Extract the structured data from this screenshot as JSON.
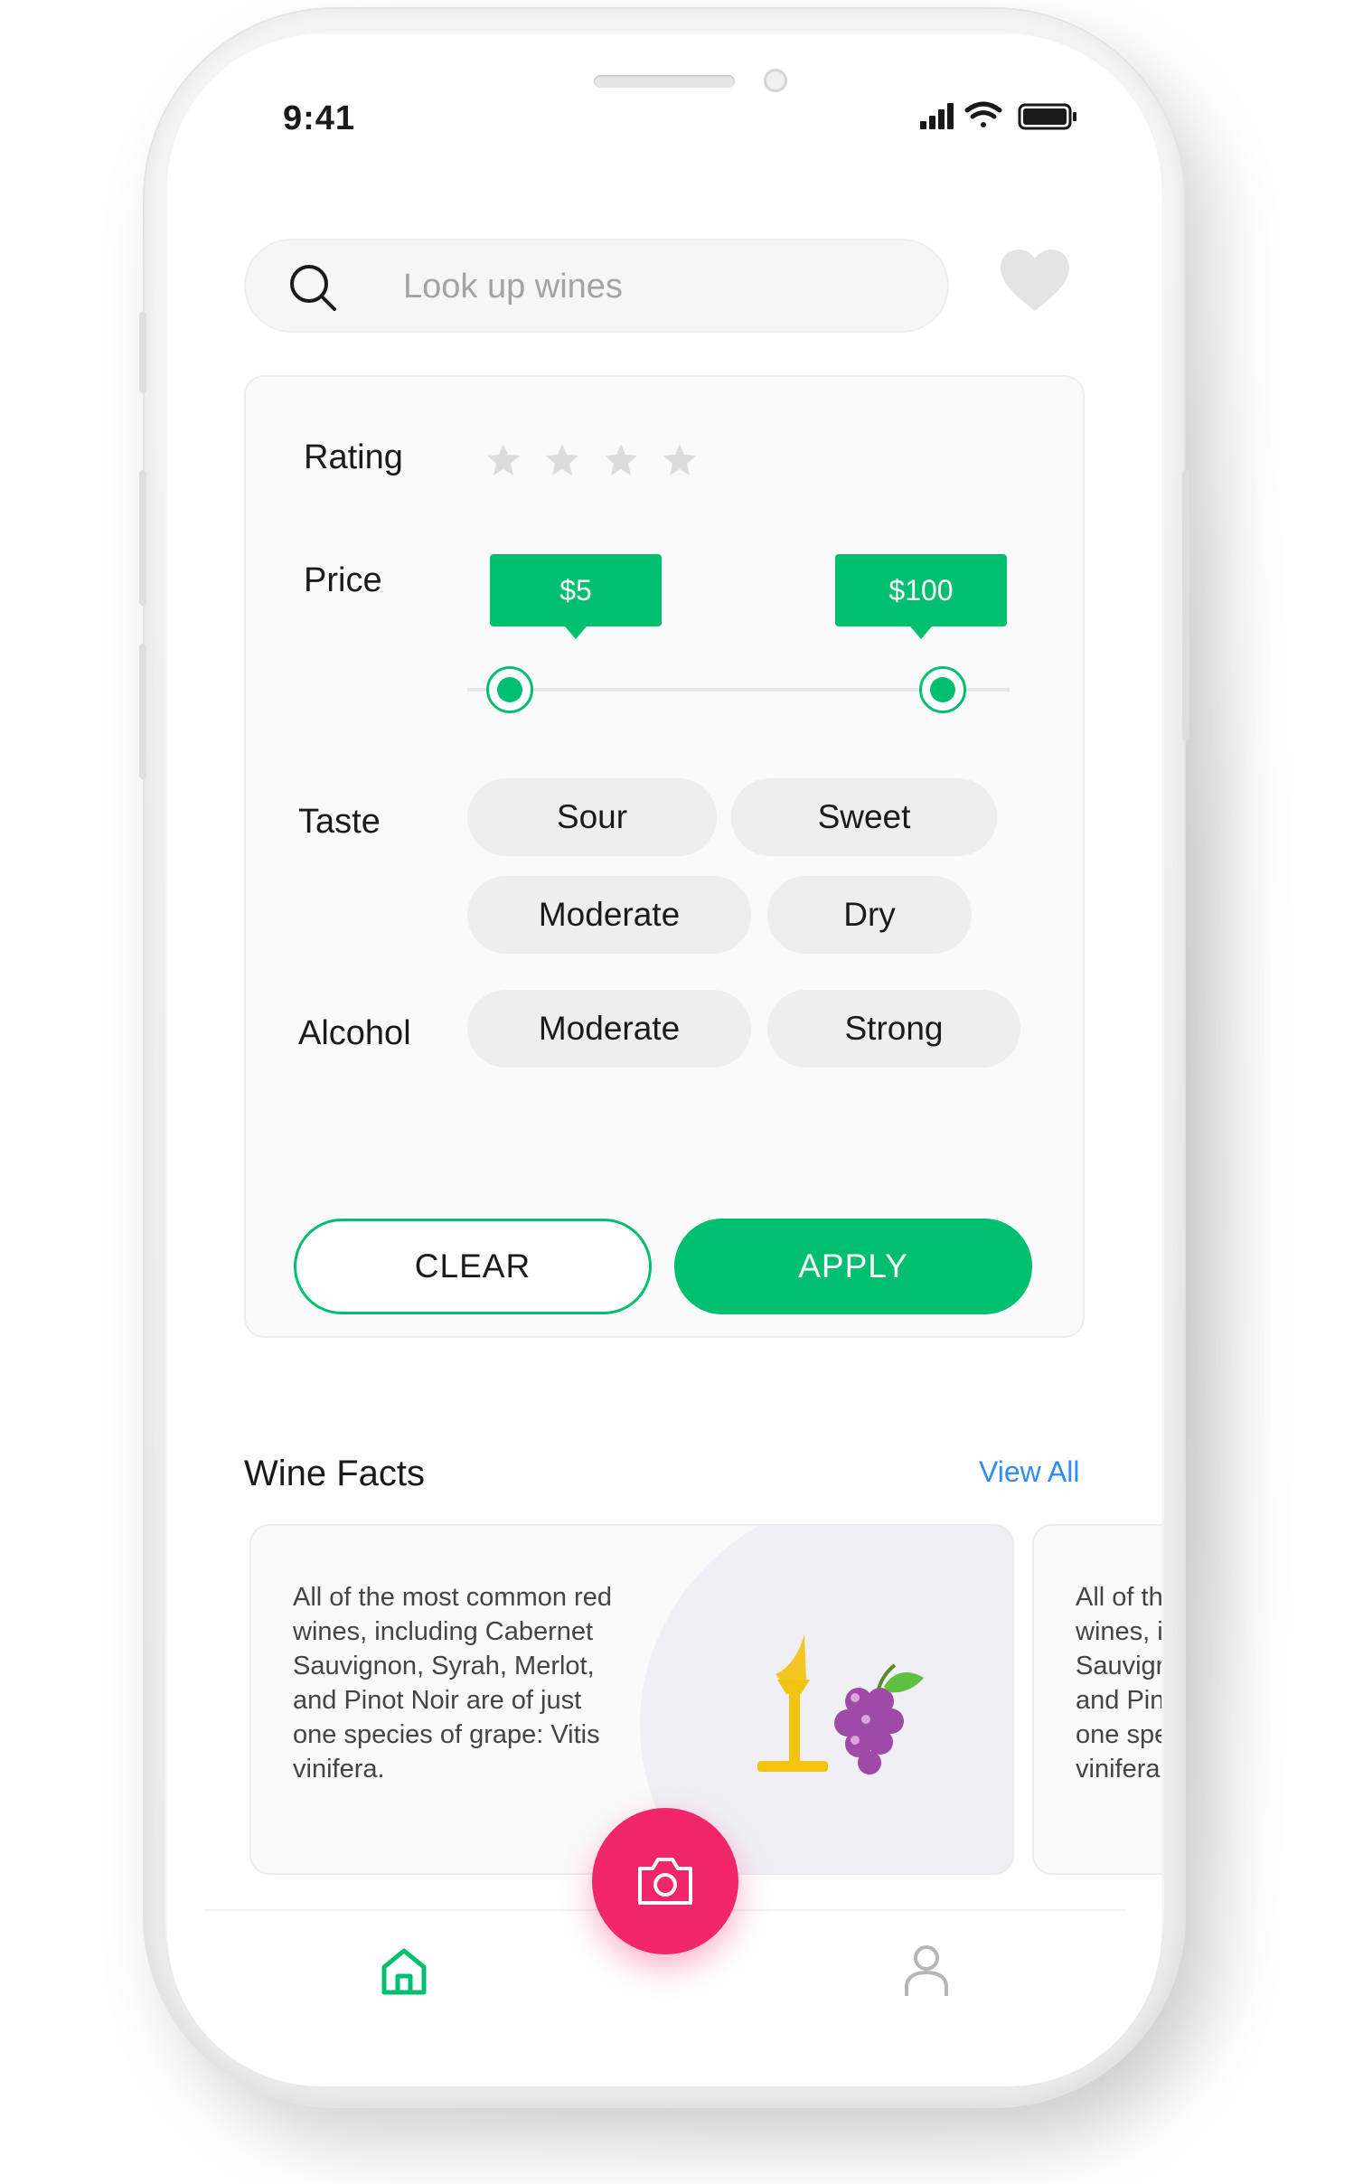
{
  "status_bar": {
    "time": "9:41",
    "icons": [
      "signal-icon",
      "wifi-icon",
      "battery-icon"
    ]
  },
  "search": {
    "placeholder": "Look up wines",
    "value": "",
    "icon": "search-icon"
  },
  "favorite": {
    "icon": "heart-icon"
  },
  "filters": {
    "rating": {
      "label": "Rating",
      "stars_total": 4,
      "stars_selected": 0
    },
    "price": {
      "label": "Price",
      "min_label": "$5",
      "max_label": "$100"
    },
    "taste": {
      "label": "Taste",
      "options": [
        "Sour",
        "Sweet",
        "Moderate",
        "Dry"
      ]
    },
    "alcohol": {
      "label": "Alcohol",
      "options": [
        "Moderate",
        "Strong"
      ]
    },
    "clear_label": "CLEAR",
    "apply_label": "APPLY"
  },
  "wine_facts": {
    "title": "Wine Facts",
    "view_all_label": "View All",
    "cards": [
      {
        "text": "All of the most common red\nwines, including Cabernet\nSauvignon, Syrah, Merlot,\nand Pinot Noir are of just\none species of grape: Vitis\nvinifera."
      },
      {
        "text": "All of the most common red\nwines, including Cabernet\nSauvignon, Syrah, Merlot,\nand Pinot Noir are of just\none species of grape: Vitis\nvinifera."
      }
    ]
  },
  "bottom_nav": {
    "items": [
      "home-icon",
      "camera-icon",
      "profile-icon"
    ]
  },
  "colors": {
    "accent": "#00bf6f",
    "fab": "#f0256a",
    "link": "#2f8cff"
  }
}
